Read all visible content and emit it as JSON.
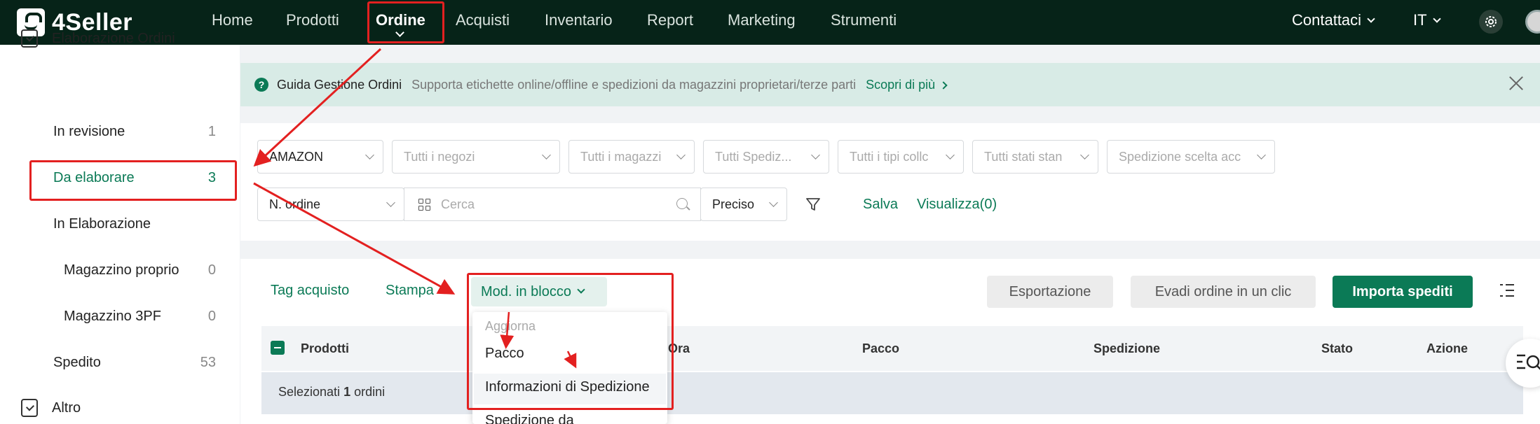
{
  "app": {
    "name": "4Seller"
  },
  "nav": {
    "items": [
      "Home",
      "Prodotti",
      "Ordine",
      "Acquisti",
      "Inventario",
      "Report",
      "Marketing",
      "Strumenti"
    ],
    "active": "Ordine",
    "contact": "Contattaci",
    "language": "IT"
  },
  "sidebar": {
    "section": "Elaborazione Ordini",
    "items": [
      {
        "label": "In revisione",
        "count": "1"
      },
      {
        "label": "Da elaborare",
        "count": "3"
      },
      {
        "label": "In Elaborazione",
        "count": ""
      },
      {
        "label": "Magazzino proprio",
        "count": "0"
      },
      {
        "label": "Magazzino 3PF",
        "count": "0"
      },
      {
        "label": "Spedito",
        "count": "53"
      }
    ],
    "other": "Altro"
  },
  "banner": {
    "title": "Guida Gestione Ordini",
    "text": "Supporta etichette online/offline e spedizioni da magazzini proprietari/terze parti",
    "link": "Scopri di più"
  },
  "filters": {
    "selects": [
      "AMAZON",
      "Tutti i negozi",
      "Tutti i magazzi",
      "Tutti Spediz...",
      "Tutti i tipi collc",
      "Tutti stati stan",
      "Spedizione scelta acc"
    ],
    "order_field": "N. ordine",
    "search_placeholder": "Cerca",
    "match": "Preciso",
    "save": "Salva",
    "view": "Visualizza(0)"
  },
  "toolbar": {
    "tag": "Tag acquisto",
    "print": "Stampa",
    "bulk": "Mod. in blocco",
    "export": "Esportazione",
    "fulfill": "Evadi ordine in un clic",
    "import": "Importa spediti"
  },
  "table": {
    "headers": [
      "Prodotti",
      "Ora",
      "Pacco",
      "Spedizione",
      "Stato",
      "Azione"
    ],
    "selected_prefix": "Selezionati",
    "selected_count": "1",
    "selected_suffix": "ordini"
  },
  "dropdown": {
    "header": "Aggiorna",
    "items": [
      "Pacco",
      "Informazioni di Spedizione",
      "Spedizione da"
    ]
  },
  "colors": {
    "nav_bg": "#062318",
    "accent": "#0b7a56",
    "annotation": "#e32020"
  }
}
